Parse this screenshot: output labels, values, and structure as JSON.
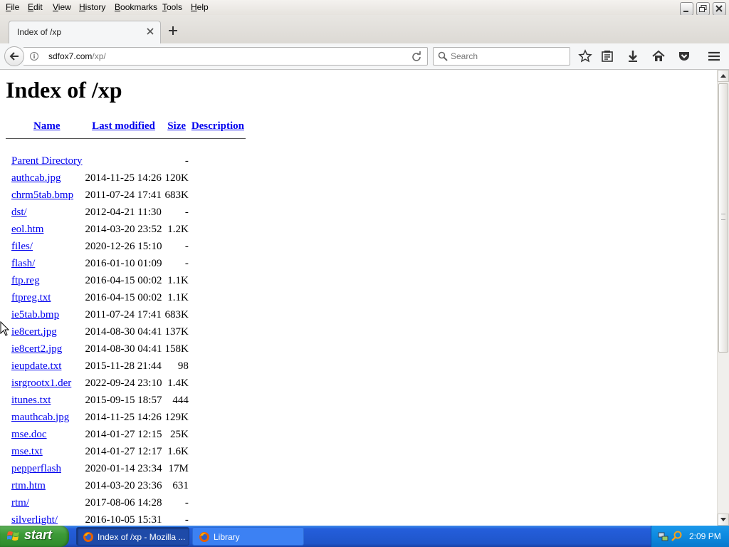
{
  "menubar": {
    "items": [
      {
        "label": "File",
        "hotkey": "F",
        "rest": "ile"
      },
      {
        "label": "Edit",
        "hotkey": "E",
        "rest": "dit"
      },
      {
        "label": "View",
        "hotkey": "V",
        "rest": "iew"
      },
      {
        "label": "History",
        "hotkey": "H",
        "rest": "istory"
      },
      {
        "label": "Bookmarks",
        "hotkey": "B",
        "rest": "ookmarks"
      },
      {
        "label": "Tools",
        "hotkey": "T",
        "rest": "ools"
      },
      {
        "label": "Help",
        "hotkey": "H",
        "rest": "elp"
      }
    ]
  },
  "tab": {
    "title": "Index of /xp"
  },
  "urlbar": {
    "host": "sdfox7.com",
    "path": "/xp/"
  },
  "search": {
    "placeholder": "Search"
  },
  "page": {
    "title": "Index of /xp",
    "columns": {
      "name": "Name",
      "modified": "Last modified",
      "size": "Size",
      "description": "Description"
    },
    "parent": {
      "name": "Parent Directory",
      "size": "-"
    },
    "rows": [
      {
        "name": "authcab.jpg",
        "modified": "2014-11-25 14:26",
        "size": "120K"
      },
      {
        "name": "chrm5tab.bmp",
        "modified": "2011-07-24 17:41",
        "size": "683K"
      },
      {
        "name": "dst/",
        "modified": "2012-04-21 11:30",
        "size": "-"
      },
      {
        "name": "eol.htm",
        "modified": "2014-03-20 23:52",
        "size": "1.2K"
      },
      {
        "name": "files/",
        "modified": "2020-12-26 15:10",
        "size": "-"
      },
      {
        "name": "flash/",
        "modified": "2016-01-10 01:09",
        "size": "-"
      },
      {
        "name": "ftp.reg",
        "modified": "2016-04-15 00:02",
        "size": "1.1K"
      },
      {
        "name": "ftpreg.txt",
        "modified": "2016-04-15 00:02",
        "size": "1.1K"
      },
      {
        "name": "ie5tab.bmp",
        "modified": "2011-07-24 17:41",
        "size": "683K"
      },
      {
        "name": "ie8cert.jpg",
        "modified": "2014-08-30 04:41",
        "size": "137K"
      },
      {
        "name": "ie8cert2.jpg",
        "modified": "2014-08-30 04:41",
        "size": "158K"
      },
      {
        "name": "ieupdate.txt",
        "modified": "2015-11-28 21:44",
        "size": "98"
      },
      {
        "name": "isrgrootx1.der",
        "modified": "2022-09-24 23:10",
        "size": "1.4K"
      },
      {
        "name": "itunes.txt",
        "modified": "2015-09-15 18:57",
        "size": "444"
      },
      {
        "name": "mauthcab.jpg",
        "modified": "2014-11-25 14:26",
        "size": "129K"
      },
      {
        "name": "mse.doc",
        "modified": "2014-01-27 12:15",
        "size": "25K"
      },
      {
        "name": "mse.txt",
        "modified": "2014-01-27 12:17",
        "size": "1.6K"
      },
      {
        "name": "pepperflash",
        "modified": "2020-01-14 23:34",
        "size": "17M"
      },
      {
        "name": "rtm.htm",
        "modified": "2014-03-20 23:36",
        "size": "631"
      },
      {
        "name": "rtm/",
        "modified": "2017-08-06 14:28",
        "size": "-"
      },
      {
        "name": "silverlight/",
        "modified": "2016-10-05 15:31",
        "size": "-"
      }
    ]
  },
  "taskbar": {
    "start_label": "start",
    "tasks": [
      {
        "label": "Index of /xp - Mozilla ...",
        "icon": "firefox-icon",
        "active": true
      },
      {
        "label": "Library",
        "icon": "firefox-icon",
        "active": false
      }
    ],
    "clock": "2:09 PM"
  },
  "colors": {
    "link": "#0000ee",
    "taskbar": "#245edb",
    "start": "#3c9a37"
  }
}
